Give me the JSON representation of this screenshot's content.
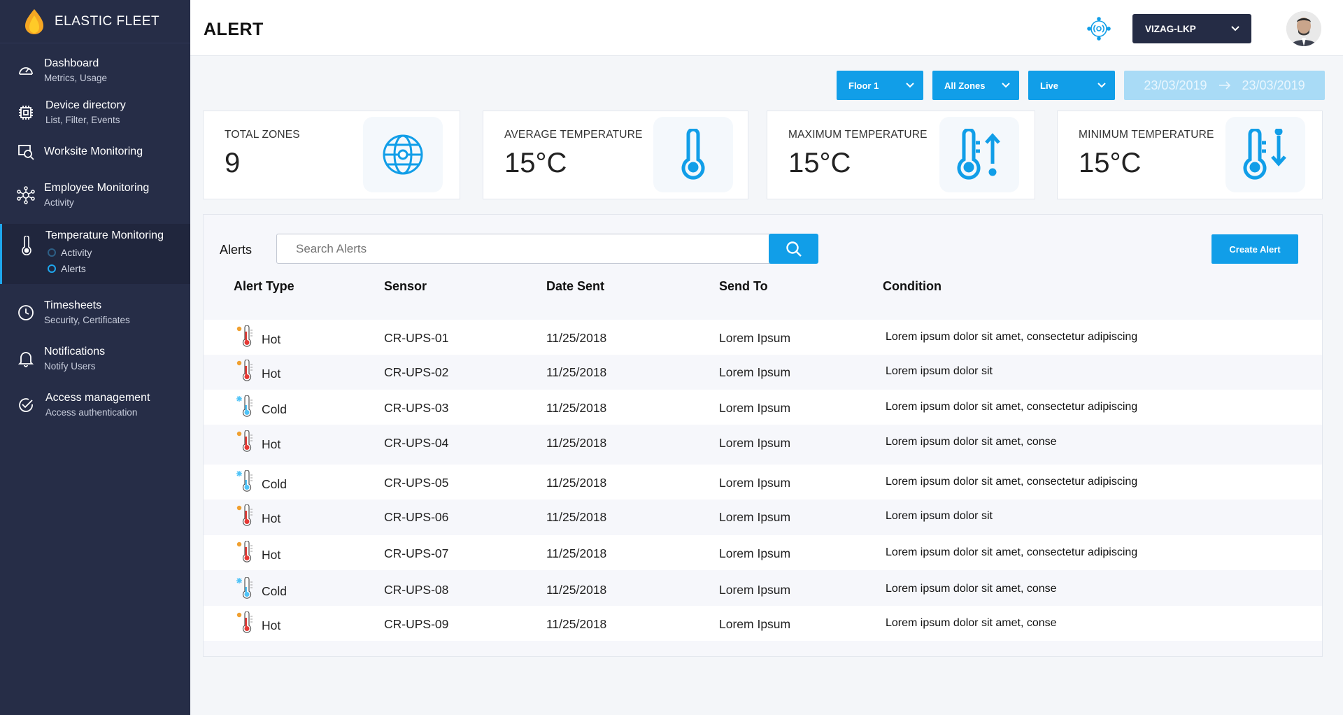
{
  "app": {
    "brand": "ELASTIC FLEET"
  },
  "sidebar": {
    "items": [
      {
        "title": "Dashboard",
        "sub": "Metrics, Usage",
        "icon": "gauge-icon"
      },
      {
        "title": "Device directory",
        "sub": "List, Filter, Events",
        "icon": "chip-icon"
      },
      {
        "title": "Worksite Monitoring",
        "sub": "",
        "icon": "worksite-icon"
      },
      {
        "title": "Employee Monitoring",
        "sub": "Activity",
        "icon": "network-icon"
      },
      {
        "title": "Temperature Monitoring",
        "sub": "",
        "icon": "thermometer-icon",
        "children": [
          "Activity",
          "Alerts"
        ]
      },
      {
        "title": "Timesheets",
        "sub": "Security, Certificates",
        "icon": "clock-icon"
      },
      {
        "title": "Notifications",
        "sub": "Notify Users",
        "icon": "bell-icon"
      },
      {
        "title": "Access management",
        "sub": "Access authentication",
        "icon": "check-circle-icon"
      }
    ]
  },
  "header": {
    "title": "ALERT",
    "site": "VIZAG-LKP"
  },
  "filters": {
    "floor": "Floor 1",
    "zones": "All Zones",
    "mode": "Live",
    "date_from": "23/03/2019",
    "date_to": "23/03/2019"
  },
  "stats": [
    {
      "label": "TOTAL ZONES",
      "value": "9",
      "icon": "globe-icon"
    },
    {
      "label": "AVERAGE TEMPERATURE",
      "value": "15°C",
      "icon": "thermometer-icon"
    },
    {
      "label": "MAXIMUM TEMPERATURE",
      "value": "15°C",
      "icon": "thermometer-up-icon"
    },
    {
      "label": "MINIMUM TEMPERATURE",
      "value": "15°C",
      "icon": "thermometer-down-icon"
    }
  ],
  "alerts": {
    "label": "Alerts",
    "search_placeholder": "Search Alerts",
    "create_label": "Create Alert",
    "columns": [
      "Alert Type",
      "Sensor",
      "Date Sent",
      "Send To",
      "Condition"
    ],
    "rows": [
      {
        "type": "Hot",
        "sensor": "CR-UPS-01",
        "date": "11/25/2018",
        "send_to": "Lorem Ipsum",
        "condition": "Lorem ipsum dolor sit amet, consectetur adipiscing"
      },
      {
        "type": "Hot",
        "sensor": "CR-UPS-02",
        "date": "11/25/2018",
        "send_to": "Lorem Ipsum",
        "condition": "Lorem ipsum dolor sit"
      },
      {
        "type": "Cold",
        "sensor": "CR-UPS-03",
        "date": "11/25/2018",
        "send_to": "Lorem Ipsum",
        "condition": "Lorem ipsum dolor sit amet, consectetur adipiscing"
      },
      {
        "type": "Hot",
        "sensor": "CR-UPS-04",
        "date": "11/25/2018",
        "send_to": "Lorem Ipsum",
        "condition": "Lorem ipsum dolor sit amet, conse"
      },
      {
        "type": "Cold",
        "sensor": "CR-UPS-05",
        "date": "11/25/2018",
        "send_to": "Lorem Ipsum",
        "condition": "Lorem ipsum dolor sit amet, consectetur adipiscing"
      },
      {
        "type": "Hot",
        "sensor": "CR-UPS-06",
        "date": "11/25/2018",
        "send_to": "Lorem Ipsum",
        "condition": "Lorem ipsum dolor sit"
      },
      {
        "type": "Hot",
        "sensor": "CR-UPS-07",
        "date": "11/25/2018",
        "send_to": "Lorem Ipsum",
        "condition": "Lorem ipsum dolor sit amet, consectetur adipiscing"
      },
      {
        "type": "Cold",
        "sensor": "CR-UPS-08",
        "date": "11/25/2018",
        "send_to": "Lorem Ipsum",
        "condition": "Lorem ipsum dolor sit amet, conse"
      },
      {
        "type": "Hot",
        "sensor": "CR-UPS-09",
        "date": "11/25/2018",
        "send_to": "Lorem Ipsum",
        "condition": "Lorem ipsum dolor sit amet, conse"
      }
    ]
  },
  "colors": {
    "sidebar": "#262d47",
    "accent": "#119ee8",
    "hot": "#e53935",
    "cold": "#4fc3f7"
  }
}
